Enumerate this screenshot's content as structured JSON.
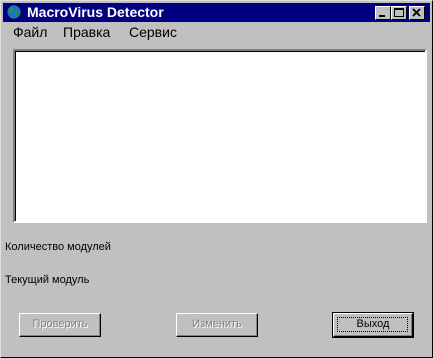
{
  "window": {
    "title": "MacroVirus Detector",
    "icon": "globe-icon"
  },
  "titlebar_buttons": {
    "minimize": "minimize-icon",
    "maximize": "maximize-icon",
    "close": "close-icon"
  },
  "menu": [
    "Файл",
    "Правка",
    "Сервис"
  ],
  "labels": {
    "module_count": "Количество модулей",
    "current_module": "Текущий модуль"
  },
  "buttons": {
    "check": "Проверить",
    "change": "Изменить",
    "exit": "Выход"
  },
  "colors": {
    "titlebar": "#000080",
    "face": "#c0c0c0"
  }
}
